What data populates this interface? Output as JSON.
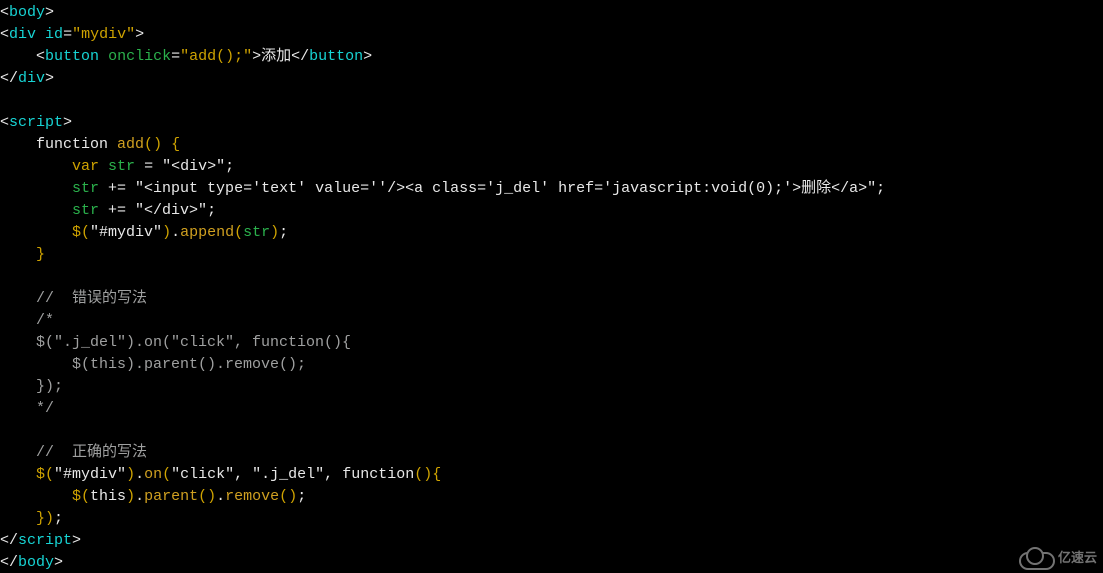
{
  "watermark": {
    "label": "亿速云"
  },
  "code": {
    "lines": [
      [
        {
          "t": "<",
          "c": "c-white"
        },
        {
          "t": "body",
          "c": "c-tag"
        },
        {
          "t": ">",
          "c": "c-white"
        }
      ],
      [
        {
          "t": "<",
          "c": "c-white"
        },
        {
          "t": "div",
          "c": "c-tag"
        },
        {
          "t": " ",
          "c": ""
        },
        {
          "t": "id",
          "c": "c-attr-id"
        },
        {
          "t": "=",
          "c": "c-white"
        },
        {
          "t": "\"mydiv\"",
          "c": "c-orange"
        },
        {
          "t": ">",
          "c": "c-white"
        }
      ],
      [
        {
          "t": "    ",
          "c": ""
        },
        {
          "t": "<",
          "c": "c-white"
        },
        {
          "t": "button",
          "c": "c-tag"
        },
        {
          "t": " ",
          "c": ""
        },
        {
          "t": "onclick",
          "c": "c-attr-g"
        },
        {
          "t": "=",
          "c": "c-white"
        },
        {
          "t": "\"add();\"",
          "c": "c-orange"
        },
        {
          "t": ">",
          "c": "c-white"
        },
        {
          "t": "添加",
          "c": "c-white"
        },
        {
          "t": "</",
          "c": "c-white"
        },
        {
          "t": "button",
          "c": "c-tag"
        },
        {
          "t": ">",
          "c": "c-white"
        }
      ],
      [
        {
          "t": "</",
          "c": "c-white"
        },
        {
          "t": "div",
          "c": "c-tag"
        },
        {
          "t": ">",
          "c": "c-white"
        }
      ],
      [
        {
          "t": " ",
          "c": ""
        }
      ],
      [
        {
          "t": "<",
          "c": "c-white"
        },
        {
          "t": "script",
          "c": "c-tag"
        },
        {
          "t": ">",
          "c": "c-white"
        }
      ],
      [
        {
          "t": "    function ",
          "c": "c-white"
        },
        {
          "t": "add",
          "c": "c-func"
        },
        {
          "t": "(",
          "c": "c-orange"
        },
        {
          "t": ")",
          "c": "c-orange"
        },
        {
          "t": " ",
          "c": ""
        },
        {
          "t": "{",
          "c": "c-orange"
        }
      ],
      [
        {
          "t": "        ",
          "c": ""
        },
        {
          "t": "var",
          "c": "c-orange"
        },
        {
          "t": " ",
          "c": ""
        },
        {
          "t": "str",
          "c": "c-attr-g"
        },
        {
          "t": " = ",
          "c": "c-white"
        },
        {
          "t": "\"<div>\"",
          "c": "c-white"
        },
        {
          "t": ";",
          "c": "c-white"
        }
      ],
      [
        {
          "t": "        ",
          "c": ""
        },
        {
          "t": "str",
          "c": "c-attr-g"
        },
        {
          "t": " += ",
          "c": "c-white"
        },
        {
          "t": "\"<input type='text' value=''/><a class='j_del' href='javascript:void(0);'>删除</a>\"",
          "c": "c-white"
        },
        {
          "t": ";",
          "c": "c-white"
        }
      ],
      [
        {
          "t": "        ",
          "c": ""
        },
        {
          "t": "str",
          "c": "c-attr-g"
        },
        {
          "t": " += ",
          "c": "c-white"
        },
        {
          "t": "\"</div>\"",
          "c": "c-white"
        },
        {
          "t": ";",
          "c": "c-white"
        }
      ],
      [
        {
          "t": "        ",
          "c": ""
        },
        {
          "t": "$",
          "c": "c-orange"
        },
        {
          "t": "(",
          "c": "c-orange"
        },
        {
          "t": "\"#mydiv\"",
          "c": "c-white"
        },
        {
          "t": ")",
          "c": "c-orange"
        },
        {
          "t": ".",
          "c": "c-white"
        },
        {
          "t": "append",
          "c": "c-func"
        },
        {
          "t": "(",
          "c": "c-orange"
        },
        {
          "t": "str",
          "c": "c-attr-g"
        },
        {
          "t": ")",
          "c": "c-orange"
        },
        {
          "t": ";",
          "c": "c-white"
        }
      ],
      [
        {
          "t": "    ",
          "c": ""
        },
        {
          "t": "}",
          "c": "c-orange"
        }
      ],
      [
        {
          "t": " ",
          "c": ""
        }
      ],
      [
        {
          "t": "    //  错误的写法",
          "c": "c-comment"
        }
      ],
      [
        {
          "t": "    /*",
          "c": "c-comment"
        }
      ],
      [
        {
          "t": "    $(\".j_del\").on(\"click\", function(){",
          "c": "c-comment"
        }
      ],
      [
        {
          "t": "        $(this).parent().remove();",
          "c": "c-comment"
        }
      ],
      [
        {
          "t": "    });",
          "c": "c-comment"
        }
      ],
      [
        {
          "t": "    */",
          "c": "c-comment"
        }
      ],
      [
        {
          "t": " ",
          "c": ""
        }
      ],
      [
        {
          "t": "    //  正确的写法",
          "c": "c-comment"
        }
      ],
      [
        {
          "t": "    ",
          "c": ""
        },
        {
          "t": "$",
          "c": "c-orange"
        },
        {
          "t": "(",
          "c": "c-orange"
        },
        {
          "t": "\"#mydiv\"",
          "c": "c-white"
        },
        {
          "t": ")",
          "c": "c-orange"
        },
        {
          "t": ".",
          "c": "c-white"
        },
        {
          "t": "on",
          "c": "c-func"
        },
        {
          "t": "(",
          "c": "c-orange"
        },
        {
          "t": "\"click\"",
          "c": "c-white"
        },
        {
          "t": ", ",
          "c": "c-white"
        },
        {
          "t": "\".j_del\"",
          "c": "c-white"
        },
        {
          "t": ", ",
          "c": "c-white"
        },
        {
          "t": "function",
          "c": "c-white"
        },
        {
          "t": "(",
          "c": "c-orange"
        },
        {
          "t": ")",
          "c": "c-orange"
        },
        {
          "t": "{",
          "c": "c-orange"
        }
      ],
      [
        {
          "t": "        ",
          "c": ""
        },
        {
          "t": "$",
          "c": "c-orange"
        },
        {
          "t": "(",
          "c": "c-orange"
        },
        {
          "t": "this",
          "c": "c-white"
        },
        {
          "t": ")",
          "c": "c-orange"
        },
        {
          "t": ".",
          "c": "c-white"
        },
        {
          "t": "parent",
          "c": "c-func"
        },
        {
          "t": "(",
          "c": "c-orange"
        },
        {
          "t": ")",
          "c": "c-orange"
        },
        {
          "t": ".",
          "c": "c-white"
        },
        {
          "t": "remove",
          "c": "c-func"
        },
        {
          "t": "(",
          "c": "c-orange"
        },
        {
          "t": ")",
          "c": "c-orange"
        },
        {
          "t": ";",
          "c": "c-white"
        }
      ],
      [
        {
          "t": "    ",
          "c": ""
        },
        {
          "t": "}",
          "c": "c-orange"
        },
        {
          "t": ")",
          "c": "c-orange"
        },
        {
          "t": ";",
          "c": "c-white"
        }
      ],
      [
        {
          "t": "</",
          "c": "c-white"
        },
        {
          "t": "script",
          "c": "c-tag"
        },
        {
          "t": ">",
          "c": "c-white"
        }
      ],
      [
        {
          "t": "</",
          "c": "c-white"
        },
        {
          "t": "body",
          "c": "c-tag"
        },
        {
          "t": ">",
          "c": "c-white"
        }
      ]
    ]
  }
}
